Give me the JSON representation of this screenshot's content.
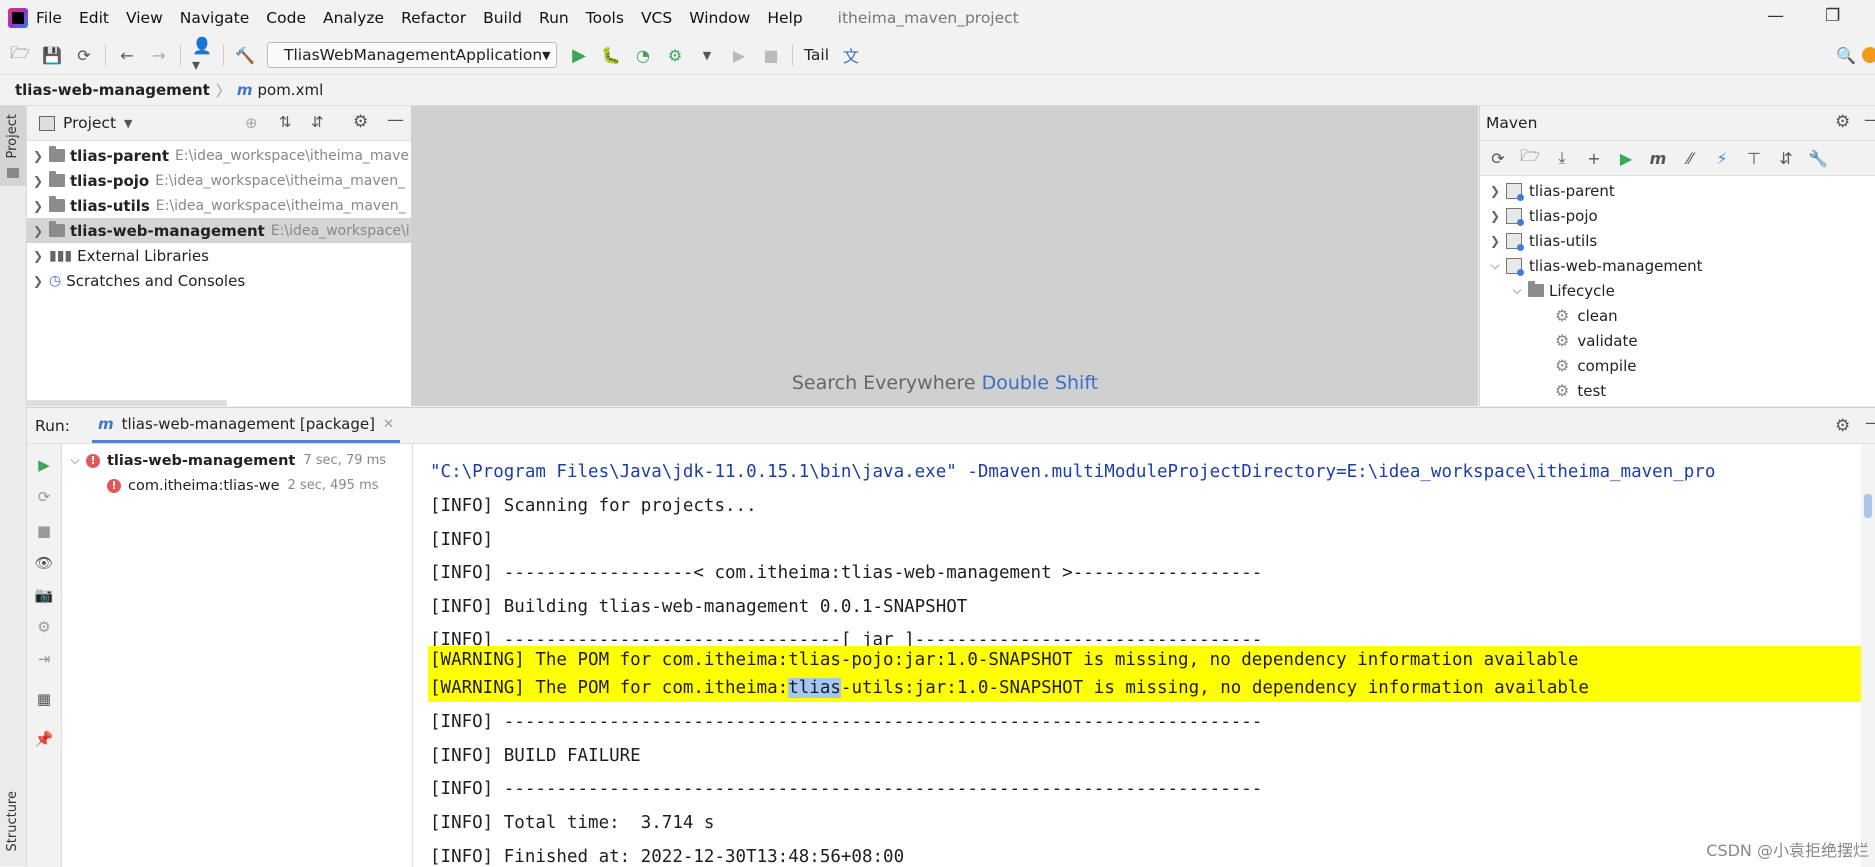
{
  "menu": {
    "items": [
      "File",
      "Edit",
      "View",
      "Navigate",
      "Code",
      "Analyze",
      "Refactor",
      "Build",
      "Run",
      "Tools",
      "VCS",
      "Window",
      "Help"
    ],
    "project_title": "itheima_maven_project"
  },
  "toolbar": {
    "run_config": "TliasWebManagementApplication",
    "tail_label": "Tail"
  },
  "breadcrumb": {
    "module": "tlias-web-management",
    "file": "pom.xml",
    "file_icon": "m"
  },
  "left_strip": {
    "project_label": "Project",
    "structure_label": "Structure"
  },
  "project_panel": {
    "title": "Project",
    "rows": [
      {
        "name": "tlias-parent",
        "path": "E:\\idea_workspace\\itheima_mave"
      },
      {
        "name": "tlias-pojo",
        "path": "E:\\idea_workspace\\itheima_maven_"
      },
      {
        "name": "tlias-utils",
        "path": "E:\\idea_workspace\\itheima_maven_"
      },
      {
        "name": "tlias-web-management",
        "path": "E:\\idea_workspace\\i"
      }
    ],
    "external_libraries": "External Libraries",
    "scratches": "Scratches and Consoles"
  },
  "editor": {
    "hint_text": "Search Everywhere",
    "hint_key": "Double Shift"
  },
  "maven": {
    "title": "Maven",
    "modules": [
      "tlias-parent",
      "tlias-pojo",
      "tlias-utils",
      "tlias-web-management"
    ],
    "lifecycle_label": "Lifecycle",
    "phases": [
      "clean",
      "validate",
      "compile",
      "test"
    ]
  },
  "run_panel": {
    "label": "Run:",
    "tab_label": "tlias-web-management [package]",
    "tree": [
      {
        "name": "tlias-web-management",
        "time": "7 sec, 79 ms"
      },
      {
        "name": "com.itheima:tlias-we",
        "time": "2 sec, 495 ms"
      }
    ]
  },
  "console": {
    "cmd": "\"C:\\Program Files\\Java\\jdk-11.0.15.1\\bin\\java.exe\" -Dmaven.multiModuleProjectDirectory=E:\\idea_workspace\\itheima_maven_pro",
    "l1": "[INFO] Scanning for projects...",
    "l2": "[INFO]",
    "l3": "[INFO] ------------------< com.itheima:tlias-web-management >------------------",
    "l4": "[INFO] Building tlias-web-management 0.0.1-SNAPSHOT",
    "l5": "[INFO] --------------------------------[ jar ]---------------------------------",
    "w1": "[WARNING] The POM for com.itheima:tlias-pojo:jar:1.0-SNAPSHOT is missing, no dependency information available",
    "w2_pre": "[WARNING] The POM for com.itheima:",
    "w2_sel": "tlias",
    "w2_post": "-utils:jar:1.0-SNAPSHOT is missing, no dependency information available",
    "l6": "[INFO] ------------------------------------------------------------------------",
    "l7": "[INFO] BUILD FAILURE",
    "l8": "[INFO] ------------------------------------------------------------------------",
    "l9": "[INFO] Total time:  3.714 s",
    "l10": "[INFO] Finished at: 2022-12-30T13:48:56+08:00"
  },
  "watermark": "CSDN @小袁拒绝摆烂",
  "colors": {
    "warning_highlight": "#ffff00",
    "selection": "#a6c8f0",
    "run_green": "#3aa757",
    "error_red": "#e55656",
    "accent_blue": "#3b6fc4"
  }
}
